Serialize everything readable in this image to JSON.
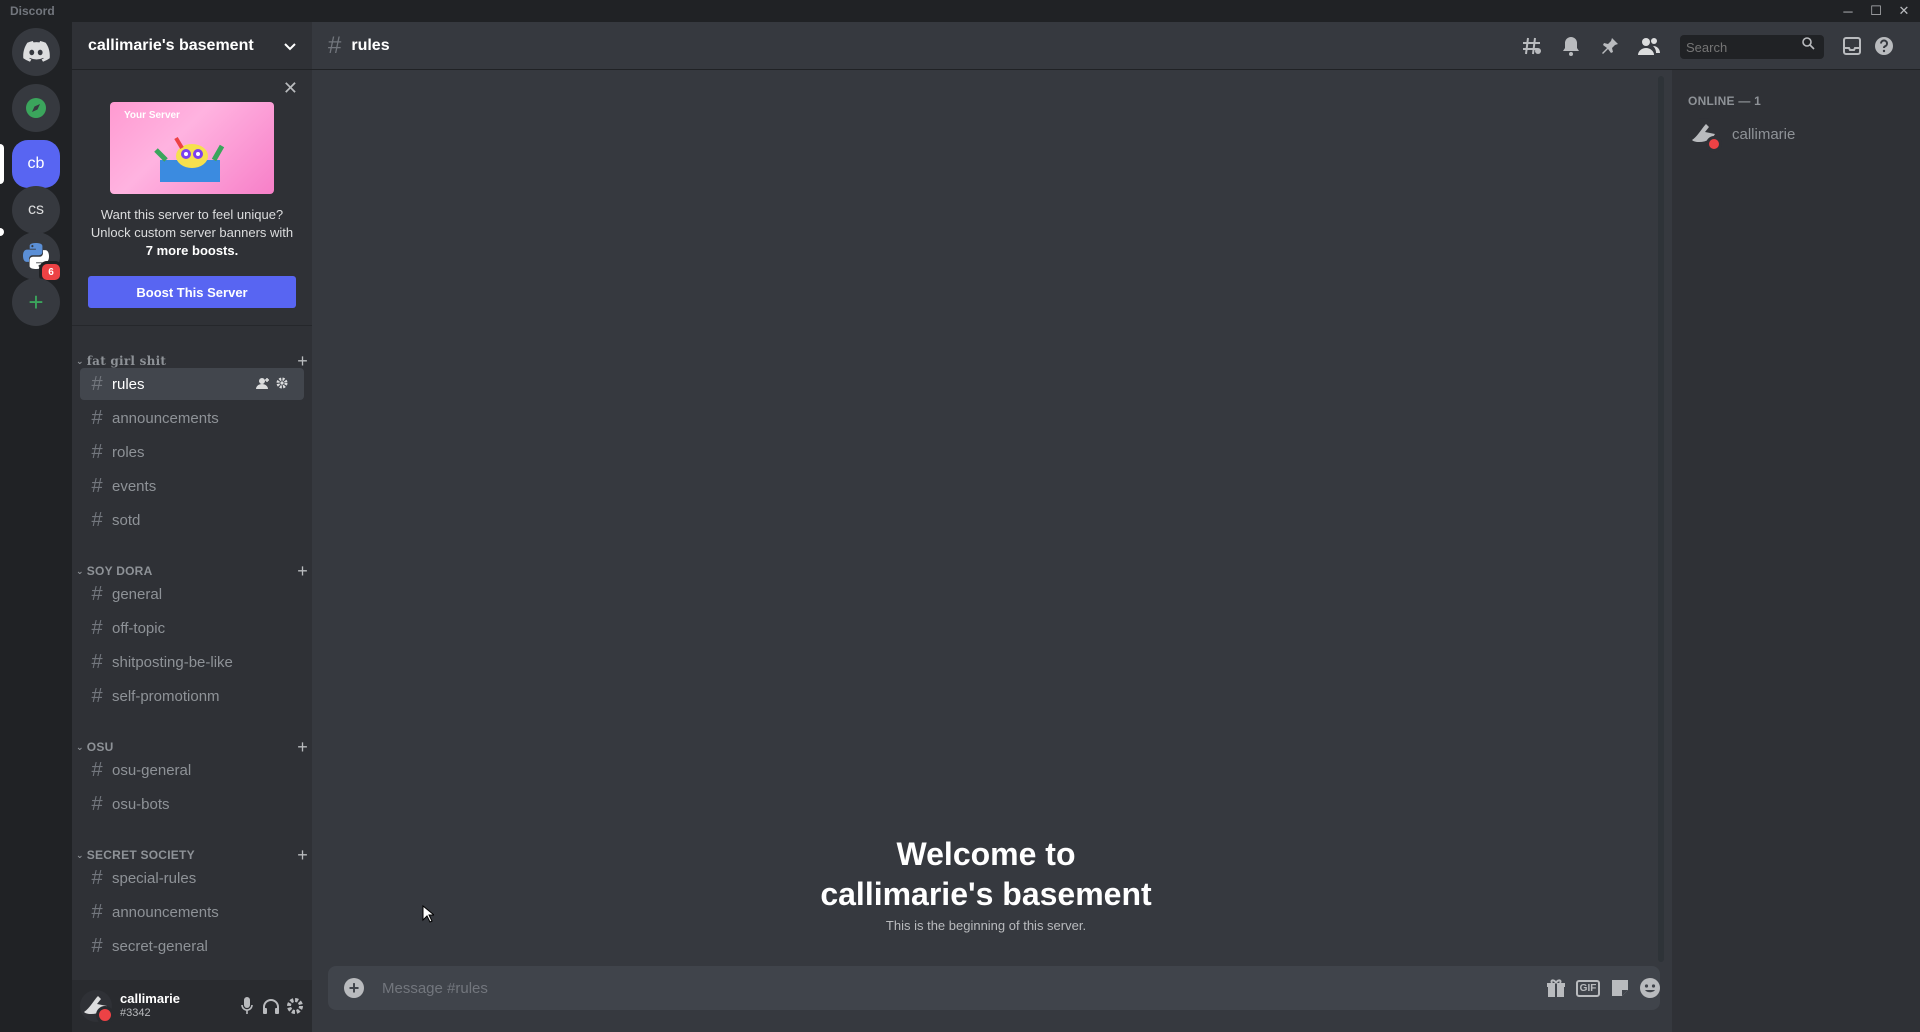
{
  "window": {
    "app_title": "Discord",
    "minimize_glyph": "─",
    "maximize_glyph": "☐",
    "close_glyph": "✕"
  },
  "servers": [
    {
      "name": "home",
      "label": "",
      "icon": "discord-logo-icon"
    },
    {
      "name": "explore",
      "label": "",
      "icon": "compass-icon"
    },
    {
      "name": "callimarie's basement",
      "label": "cb",
      "active": true
    },
    {
      "name": "cs",
      "label": "cs"
    },
    {
      "name": "python server",
      "label": "",
      "icon": "python-logo-icon",
      "badge": "6"
    },
    {
      "name": "add-server",
      "label": "+",
      "icon": "plus-icon"
    }
  ],
  "sidebar": {
    "server_name": "callimarie's basement",
    "boost": {
      "image_label": "Your Server",
      "text_line1": "Want this server to feel unique?",
      "text_line2": "Unlock custom server banners with",
      "text_bold": "7 more boosts.",
      "button": "Boost This Server"
    },
    "categories": [
      {
        "name": "fat girl shit",
        "channels": [
          "rules",
          "announcements",
          "roles",
          "events",
          "sotd"
        ]
      },
      {
        "name": "SOY DORA",
        "channels": [
          "general",
          "off-topic",
          "shitposting-be-like",
          "self-promotionm"
        ]
      },
      {
        "name": "OSU",
        "channels": [
          "osu-general",
          "osu-bots"
        ]
      },
      {
        "name": "SECRET SOCIETY",
        "channels": [
          "special-rules",
          "announcements",
          "secret-general"
        ]
      }
    ],
    "selected_channel": "rules"
  },
  "user": {
    "name": "callimarie",
    "tag": "#3342",
    "status": "dnd"
  },
  "header": {
    "channel": "rules",
    "search_placeholder": "Search"
  },
  "welcome": {
    "line1": "Welcome to",
    "line2": "callimarie's basement",
    "subtitle": "This is the beginning of this server."
  },
  "composer": {
    "placeholder": "Message #rules",
    "gif_label": "GIF"
  },
  "members": {
    "section": "ONLINE — 1",
    "list": [
      {
        "name": "callimarie",
        "status": "dnd"
      }
    ]
  },
  "colors": {
    "accent": "#5865f2",
    "dnd": "#ed4245",
    "bg_dark": "#202225",
    "bg_sidebar": "#2f3136",
    "bg_main": "#36393f"
  }
}
